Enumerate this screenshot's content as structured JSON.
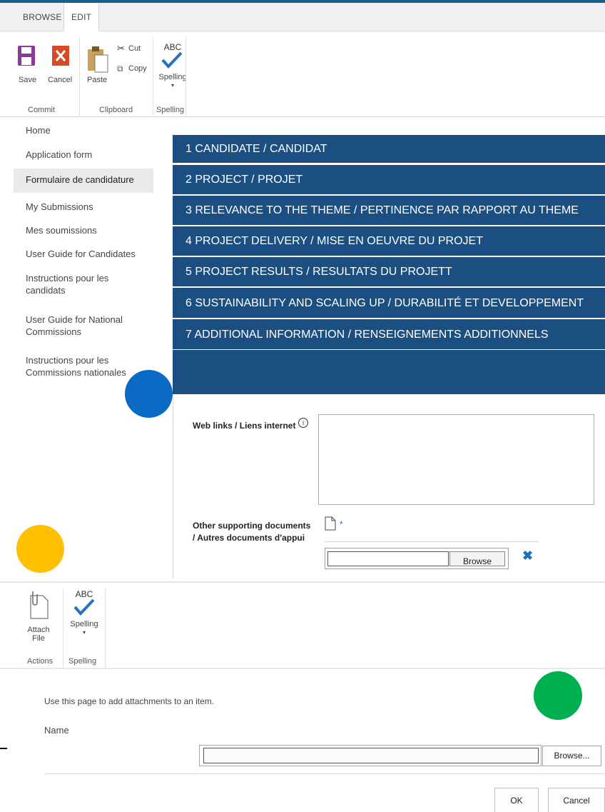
{
  "ribbon": {
    "tabs": [
      "BROWSE",
      "EDIT"
    ],
    "save": "Save",
    "cancel": "Cancel",
    "paste": "Paste",
    "cut": "Cut",
    "copy": "Copy",
    "spelling_abc": "ABC",
    "spelling": "Spelling",
    "groups": [
      "Commit",
      "Clipboard",
      "Spelling"
    ]
  },
  "nav": {
    "items": [
      "Home",
      "Application form",
      "Formulaire de candidature",
      "My Submissions",
      "Mes soumissions",
      "User Guide for Candidates",
      "Instructions pour les candidats",
      "User Guide for National Commissions",
      "Instructions pour les Commissions nationales"
    ],
    "selected": "Formulaire de candidature"
  },
  "sections": [
    "1 CANDIDATE / CANDIDAT",
    "2 PROJECT / PROJET",
    "3 RELEVANCE TO THE THEME / PERTINENCE PAR RAPPORT AU THEME",
    "4 PROJECT DELIVERY / MISE EN OEUVRE DU PROJET",
    "5 PROJECT RESULTS / RESULTATS DU PROJETT",
    "6 SUSTAINABILITY AND SCALING UP / DURABILITÉ ET DEVELOPPEMENT",
    "7 ADDITIONAL INFORMATION / RENSEIGNEMENTS ADDITIONNELS"
  ],
  "form": {
    "weblinks_label": "Web links / Liens internet",
    "weblinks_value": "",
    "docs_label_1": "Other supporting documents",
    "docs_label_2": "/ Autres documents d'appui",
    "required_mark": "*",
    "browse": "Browse"
  },
  "attach_ribbon": {
    "attach": "Attach",
    "file": "File",
    "spelling_abc": "ABC",
    "spelling": "Spelling",
    "groups": [
      "Actions",
      "Spelling"
    ]
  },
  "dialog": {
    "instruction": "Use this page to add attachments to an item.",
    "name_label": "Name",
    "browse": "Browse...",
    "ok": "OK",
    "cancel": "Cancel"
  },
  "colors": {
    "section_bg": "#1b4f82",
    "dot_blue": "#0a6ac4",
    "dot_yellow": "#ffc000",
    "dot_green": "#00b050",
    "delete_x": "#1e6fc0"
  }
}
